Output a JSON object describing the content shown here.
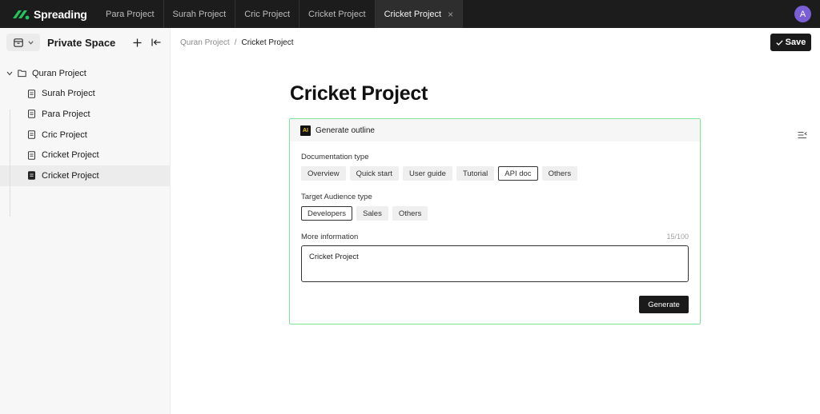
{
  "brand": {
    "name": "Spreading",
    "accent": "#22c55e"
  },
  "tabs": [
    {
      "label": "Para Project"
    },
    {
      "label": "Surah Project"
    },
    {
      "label": "Cric Project"
    },
    {
      "label": "Cricket Project"
    },
    {
      "label": "Cricket Project",
      "close": "×"
    }
  ],
  "user": {
    "avatar_initial": "A",
    "avatar_color": "#7a5ed6"
  },
  "sidebar": {
    "title": "Private Space",
    "root": {
      "label": "Quran Project",
      "icon": "folder-icon"
    },
    "items": [
      {
        "label": "Surah Project",
        "icon": "document-icon"
      },
      {
        "label": "Para Project",
        "icon": "document-icon"
      },
      {
        "label": "Cric Project",
        "icon": "document-icon"
      },
      {
        "label": "Cricket Project",
        "icon": "document-icon"
      },
      {
        "label": "Cricket Project",
        "icon": "document-filled-icon"
      }
    ]
  },
  "breadcrumb": {
    "parent": "Quran Project",
    "separator": "/",
    "current": "Cricket Project"
  },
  "toolbar": {
    "save_label": "Save"
  },
  "page": {
    "title": "Cricket Project"
  },
  "outline": {
    "badge": "AI",
    "title": "Generate outline",
    "doc_type_label": "Documentation type",
    "doc_types": [
      "Overview",
      "Quick start",
      "User guide",
      "Tutorial",
      "API doc",
      "Others"
    ],
    "doc_type_selected": "API doc",
    "audience_label": "Target Audience type",
    "audiences": [
      "Developers",
      "Sales",
      "Others"
    ],
    "audience_selected": "Developers",
    "info_label": "More information",
    "info_counter": "15/100",
    "info_value": "Cricket Project",
    "generate_label": "Generate"
  }
}
